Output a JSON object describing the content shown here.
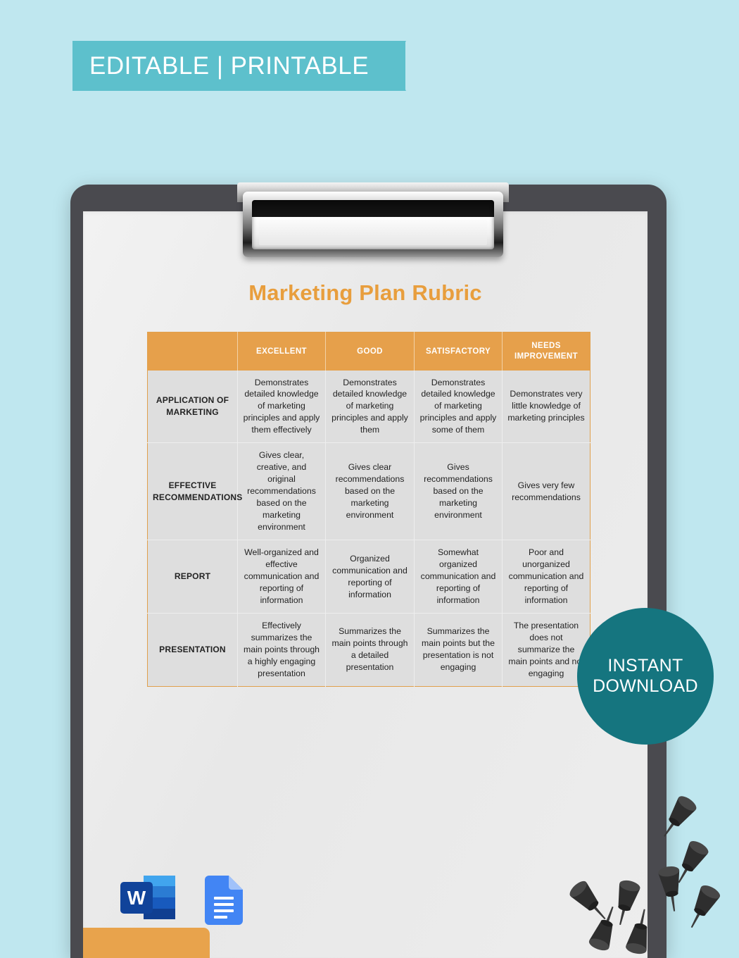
{
  "banner": {
    "label": "EDITABLE | PRINTABLE",
    "color": "#5dc0cc"
  },
  "background": {
    "color": "#bfe7ef"
  },
  "clipboard": {
    "frame_color": "#4a4a4f",
    "paper_color": "#ebebeb",
    "clip_icon": "clipboard-clip"
  },
  "document": {
    "title": "Marketing Plan Rubric",
    "title_color": "#e89e3d"
  },
  "rubric": {
    "accent_color": "#e6a04b",
    "headers": [
      "",
      "EXCELLENT",
      "GOOD",
      "SATISFACTORY",
      "NEEDS IMPROVEMENT"
    ],
    "rows": [
      {
        "criterion": "APPLICATION OF MARKETING",
        "excellent": "Demonstrates detailed knowledge of marketing principles and apply them effectively",
        "good": "Demonstrates detailed knowledge of marketing principles and apply them",
        "satisfactory": "Demonstrates detailed knowledge of marketing principles and apply some of them",
        "needs_improvement": "Demonstrates very little knowledge of marketing principles"
      },
      {
        "criterion": "EFFECTIVE RECOMMENDATIONS",
        "excellent": "Gives clear, creative, and original recommendations based on the marketing environment",
        "good": "Gives clear recommendations based on the marketing environment",
        "satisfactory": "Gives recommendations based on the marketing environment",
        "needs_improvement": "Gives very few recommendations"
      },
      {
        "criterion": "REPORT",
        "excellent": "Well-organized and effective communication and reporting of information",
        "good": "Organized communication and reporting of information",
        "satisfactory": "Somewhat organized communication and reporting of information",
        "needs_improvement": "Poor and unorganized communication and reporting of information"
      },
      {
        "criterion": "PRESENTATION",
        "excellent": "Effectively summarizes the main points through a highly engaging presentation",
        "good": "Summarizes the main points through a detailed presentation",
        "satisfactory": "Summarizes the main points but the presentation is not engaging",
        "needs_improvement": "The presentation does not summarize the main points and not engaging"
      }
    ]
  },
  "badge": {
    "line1": "INSTANT",
    "line2": "DOWNLOAD",
    "color": "#15757f"
  },
  "formats": [
    {
      "name": "word-icon",
      "label": "W"
    },
    {
      "name": "google-docs-icon",
      "label": ""
    }
  ],
  "decor": {
    "orange_bar_color": "#e8a34c",
    "pushpin_color": "#2b2b2b",
    "pushpin_count": 8
  }
}
